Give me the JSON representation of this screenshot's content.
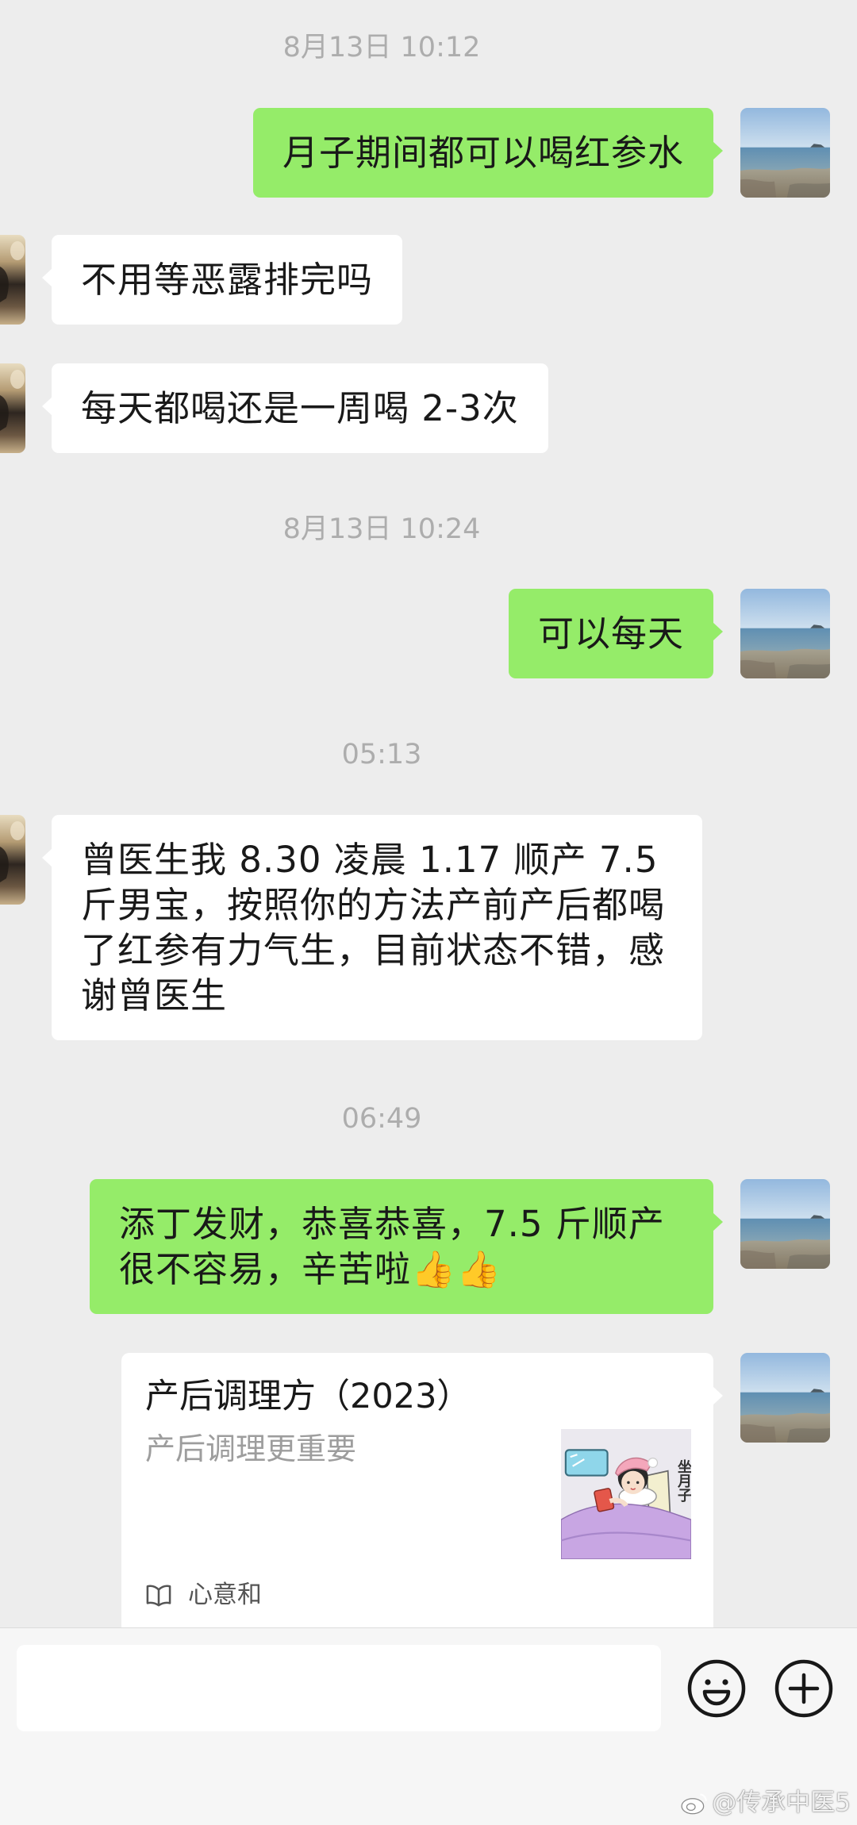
{
  "timestamps": {
    "t1": "8月13日 10:12",
    "t2": "8月13日 10:24",
    "t3": "05:13",
    "t4": "06:49"
  },
  "messages": [
    {
      "sent": true,
      "text": "月子期间都可以喝红参水"
    },
    {
      "sent": false,
      "text": "不用等恶露排完吗"
    },
    {
      "sent": false,
      "text": "每天都喝还是一周喝 2-3次"
    },
    {
      "sent": true,
      "text": "可以每天"
    },
    {
      "sent": false,
      "text": "曾医生我 8.30 凌晨 1.17 顺产 7.5 斤男宝，按照你的方法产前产后都喝了红参有力气生，目前状态不错，感谢曾医生"
    },
    {
      "sent": true,
      "text": "添丁发财，恭喜恭喜，7.5 斤顺产很不容易，辛苦啦👍👍"
    }
  ],
  "article_card": {
    "title": "产后调理方（2023）",
    "digest": "产后调理更重要",
    "thumbnail_text": "坐月子",
    "source_icon": "book-icon",
    "source": "心意和"
  },
  "input_bar": {
    "input_value": "",
    "emoji_icon": "smiley-icon",
    "more_icon": "plus-circle-icon"
  },
  "watermark": {
    "icon": "weibo-icon",
    "text": "@传承中医5"
  },
  "colors": {
    "chat_bg": "#ededed",
    "sent_bubble": "#95ec69",
    "received_bubble": "#ffffff",
    "timestamp": "#adadad",
    "input_bar_bg": "#f6f6f6"
  }
}
